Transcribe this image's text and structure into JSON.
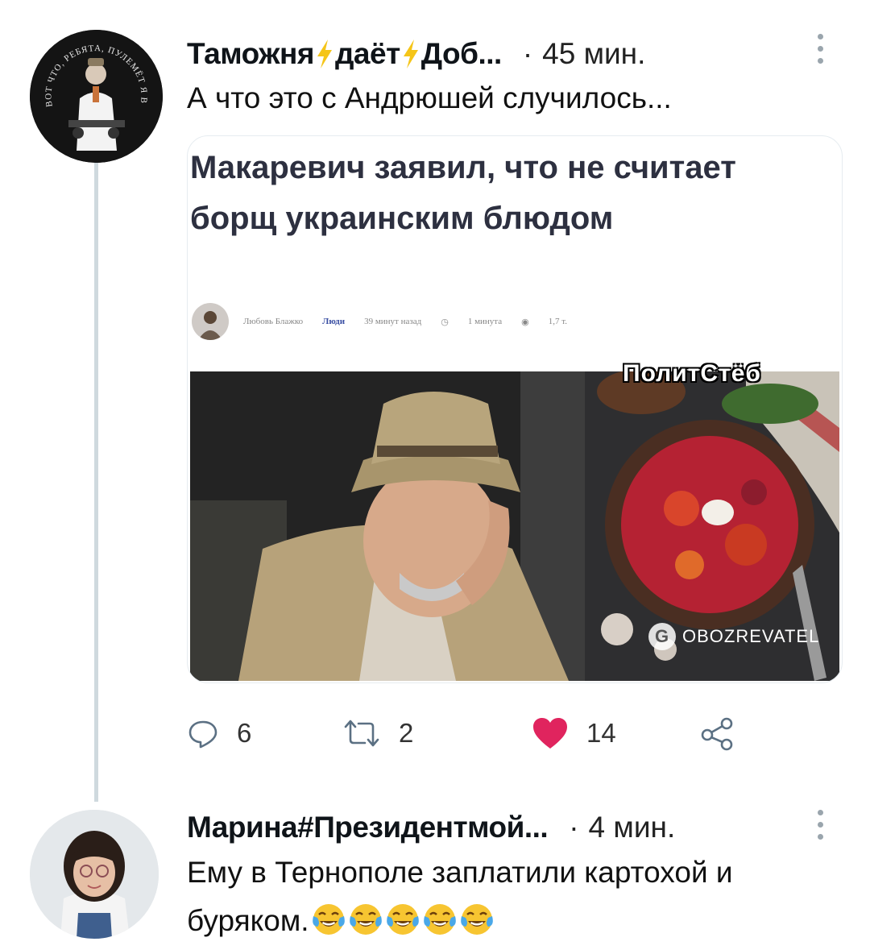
{
  "tweet1": {
    "author_name_parts": [
      "Таможня",
      "даёт",
      "Доб..."
    ],
    "separator": "·",
    "time": "45 мин.",
    "text": "А что это с Андрюшей случилось...",
    "avatar_caption": "ВОТ ЧТО, РЕБЯТА, ПУЛЕМЁТ Я ВАМ НЕ ДАМ",
    "card": {
      "headline": "Макаревич заявил, что не считает борщ украинским блюдом",
      "meta": {
        "author": "Любовь Блажко",
        "category": "Люди",
        "posted": "39 минут назад",
        "read_time": "1 минута",
        "views": "1,7 т."
      },
      "watermark": "ПолитСтёб",
      "brand": "OBOZREVATEL"
    },
    "actions": {
      "replies": "6",
      "retweets": "2",
      "likes": "14"
    },
    "colors": {
      "bolt": "#f5c518",
      "heart": "#e0245e",
      "thread_line": "#cfd9de"
    }
  },
  "tweet2": {
    "author_name": "Марина#Президентмой...",
    "separator": "·",
    "time": "4 мин.",
    "text": "Ему в Тернополе заплатили картохой и буряком.",
    "emoji": [
      "face-with-tears-of-joy",
      "face-with-tears-of-joy",
      "face-with-tears-of-joy",
      "face-with-tears-of-joy",
      "face-with-tears-of-joy"
    ]
  },
  "icons": [
    "more-vertical-icon",
    "reply-icon",
    "retweet-icon",
    "heart-icon",
    "share-icon"
  ]
}
